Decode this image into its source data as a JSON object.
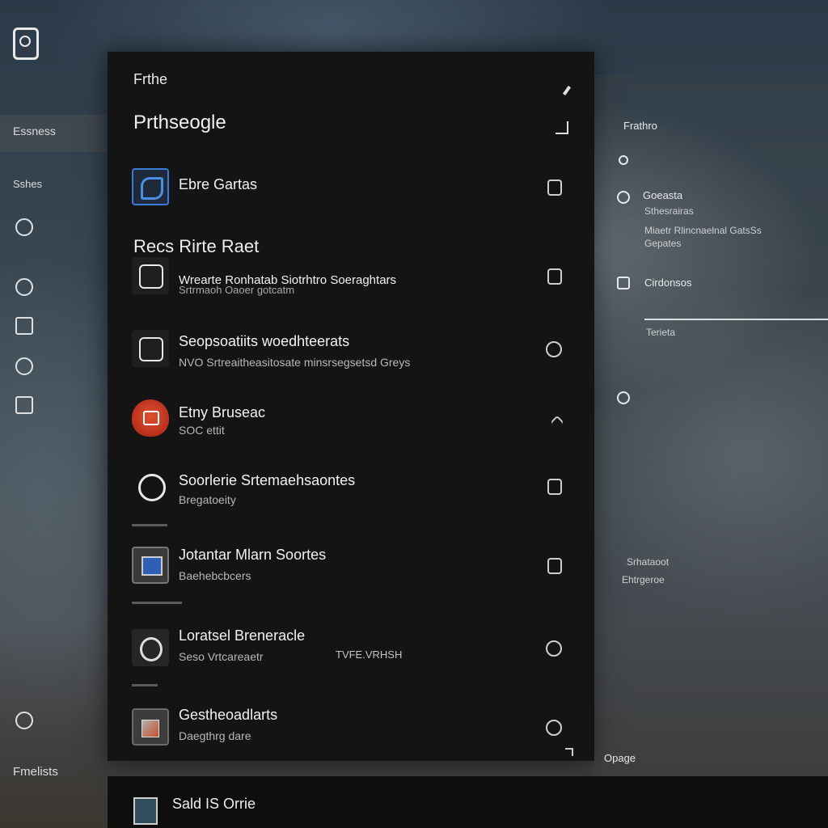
{
  "rail": {
    "active_item": "Essness",
    "sub_label": "Sshes",
    "bottom_label": "Fmelists"
  },
  "panel": {
    "title": "Frthe",
    "heading": "Prthseogle",
    "first_item": {
      "title": "Ebre Gartas"
    },
    "section_label": "Recs Rirte Raet",
    "items": [
      {
        "title": "Wrearte Ronhatab Siotrhtro Soeraghtars",
        "subtitle": "Srtrmaoh Oaoer gotcatm"
      },
      {
        "title": "Seopsoatiits woedhteerats",
        "subtitle": "NVO Srtreaitheasitosate minsrsegsetsd Greys"
      },
      {
        "title": "Etny Bruseac",
        "subtitle": "SOC ettit"
      },
      {
        "title": "Soorlerie Srtemaehsaontes",
        "subtitle": "Bregatoeity"
      },
      {
        "title": "Jotantar Mlarn Soortes",
        "subtitle": "Baehebcbcers"
      },
      {
        "title": "Loratsel Breneracle",
        "subtitle": "Seso Vrtcareaetr",
        "extra": "TVFE.VRHSH"
      },
      {
        "title": "Gestheoadlarts",
        "subtitle": "Daegthrg dare"
      }
    ]
  },
  "right_pane": {
    "header": "Frathro",
    "group_title": "Goeasta",
    "group_sub": "Sthesrairas",
    "group_desc_line1": "Miaetr Rlincnaelnal GatsSs",
    "group_desc_line2": "Gepates",
    "item2": "Cirdonsos",
    "item2_sub": "Terieta",
    "lower_line1": "Srhataoot",
    "lower_line2": "Ehtrgeroe",
    "bottom": "Opage"
  },
  "bottombar": {
    "label": "Sald IS Orrie"
  },
  "colors": {
    "panel_bg": "#141414",
    "accent_blue": "#3a7bd5",
    "accent_red": "#c8402a"
  },
  "icons": {
    "app_logo": "app-logo-icon",
    "pen": "pen-icon"
  }
}
